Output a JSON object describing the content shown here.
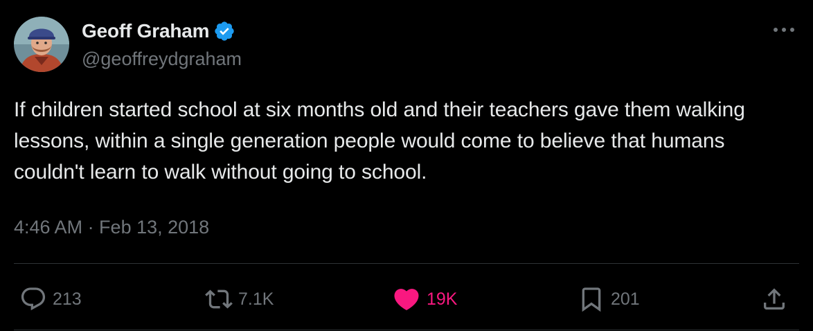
{
  "author": {
    "display_name": "Geoff Graham",
    "handle": "@geoffreydgraham",
    "verified": true
  },
  "tweet": {
    "text": "If children started school at six months old and their teachers gave them walking lessons, within a single generation people would come to believe that humans couldn't learn to walk without going to school.",
    "timestamp": "4:46 AM · Feb 13, 2018"
  },
  "actions": {
    "reply_count": "213",
    "retweet_count": "7.1K",
    "like_count": "19K",
    "bookmark_count": "201"
  },
  "icons": {
    "verified": "verified-badge-icon",
    "more": "more-dots-icon",
    "reply": "reply-bubble-icon",
    "retweet": "retweet-icon",
    "like": "heart-icon",
    "bookmark": "bookmark-icon",
    "share": "share-icon"
  },
  "colors": {
    "background": "#000000",
    "text_primary": "#e7e9ea",
    "text_secondary": "#71767b",
    "verified_blue": "#1d9bf0",
    "like_pink": "#f91880",
    "divider": "#2f3336"
  }
}
